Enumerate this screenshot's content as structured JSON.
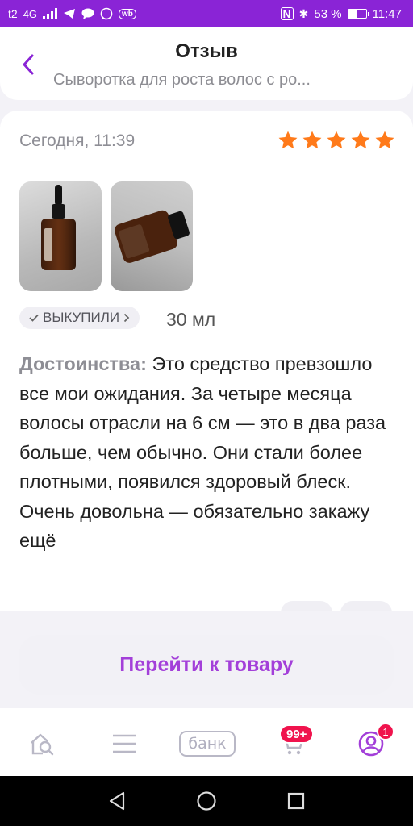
{
  "status_bar": {
    "carrier": "t2",
    "network": "4G",
    "battery": "53 %",
    "time": "11:47",
    "icons": [
      "signal-icon",
      "telegram-icon",
      "message-icon",
      "whatsapp-icon",
      "wildberries-icon",
      "nfc-icon",
      "bluetooth-icon",
      "battery-icon"
    ],
    "wb_label": "wb",
    "nfc_label": "N",
    "bt_label": "✱"
  },
  "header": {
    "title": "Отзыв",
    "subtitle": "Сыворотка для роста волос с ро..."
  },
  "review": {
    "date": "Сегодня, 11:39",
    "rating": 5,
    "star_color": "#ff7a1a",
    "bought_label": "ВЫКУПИЛИ",
    "variant": "30 мл",
    "text_label": "Достоинства:",
    "text": " Это средство превзошло все мои ожидания. За четыре месяца волосы отрасли на 6 см — это в два раза больше, чем обычно. Они стали более плотными, появился здоровый блеск. Очень довольна — обязательно закажу ещё"
  },
  "actions": {
    "go_to_product": "Перейти к товару"
  },
  "bottom_nav": {
    "items": [
      "home-search-icon",
      "catalog-icon",
      "bank-icon",
      "cart-icon",
      "profile-icon"
    ],
    "bank_label": "банк",
    "cart_badge": "99+",
    "profile_badge": "1"
  },
  "colors": {
    "accent": "#8a24d6",
    "button_text": "#a33fd9",
    "badge": "#f0134d"
  }
}
